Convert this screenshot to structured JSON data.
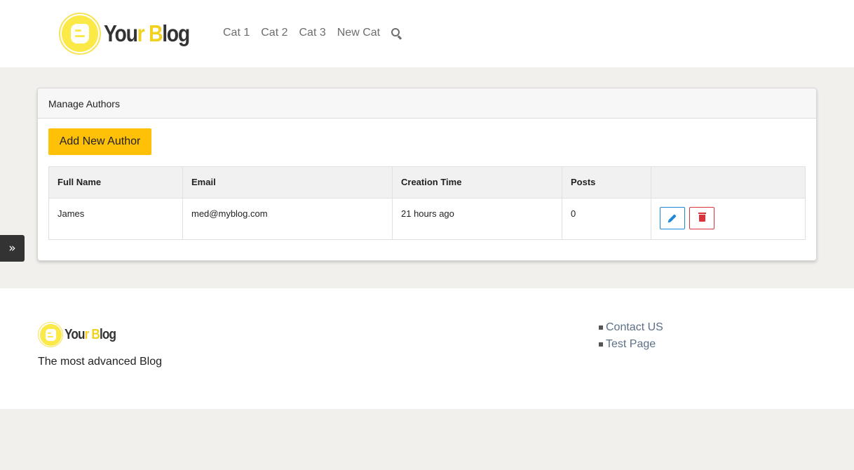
{
  "brand": {
    "name_part1": "You",
    "name_y": "r",
    "name_space_b": " B",
    "name_part2": "log"
  },
  "nav": {
    "items": [
      "Cat 1",
      "Cat 2",
      "Cat 3",
      "New Cat"
    ],
    "search_icon": "search-icon"
  },
  "sidebar_toggle": {
    "glyph": "»"
  },
  "card": {
    "title": "Manage Authors",
    "add_button": "Add New Author",
    "table": {
      "headers": [
        "Full Name",
        "Email",
        "Creation Time",
        "Posts",
        ""
      ],
      "rows": [
        {
          "full_name": "James",
          "email": "med@myblog.com",
          "creation_time": "21 hours ago",
          "posts": "0"
        }
      ]
    },
    "row_actions": {
      "edit_icon": "pencil-icon",
      "delete_icon": "trash-icon",
      "edit_color": "#1e88d8",
      "delete_color": "#d9343c"
    }
  },
  "footer": {
    "tagline": "The most advanced Blog",
    "links": [
      "Contact US",
      "Test Page"
    ]
  },
  "colors": {
    "accent": "#ffc107",
    "logo_yellow": "#fbe948",
    "link": "#5b6f86"
  }
}
